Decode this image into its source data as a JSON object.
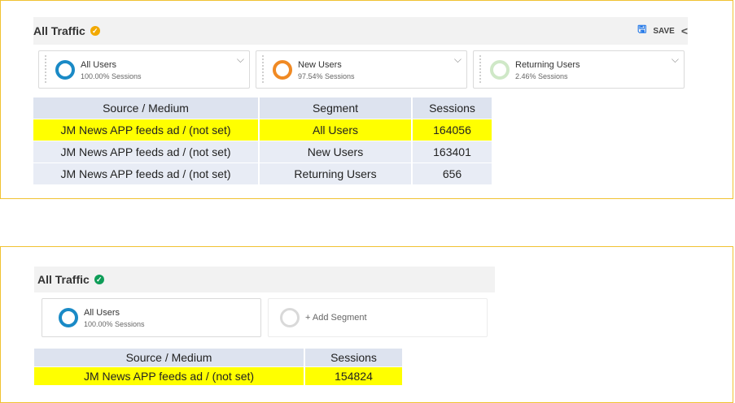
{
  "top_panel": {
    "title": "All Traffic",
    "verified_icon": "check-shield-icon",
    "save_label": "SAVE",
    "segments": [
      {
        "name": "All Users",
        "sub": "100.00% Sessions",
        "color": "#1a8ac6",
        "icon": "segment-ring-icon"
      },
      {
        "name": "New Users",
        "sub": "97.54% Sessions",
        "color": "#f08a24",
        "icon": "segment-ring-icon"
      },
      {
        "name": "Returning Users",
        "sub": "2.46% Sessions",
        "color": "#cfe8c7",
        "icon": "segment-ring-icon"
      }
    ],
    "table": {
      "headers": [
        "Source / Medium",
        "Segment",
        "Sessions"
      ],
      "rows": [
        [
          "JM News APP feeds ad / (not set)",
          "All Users",
          "164056"
        ],
        [
          "JM News APP feeds ad / (not set)",
          "New Users",
          "163401"
        ],
        [
          "JM News APP feeds ad / (not set)",
          "Returning Users",
          "656"
        ]
      ]
    }
  },
  "bottom_panel": {
    "title": "All Traffic",
    "verified_icon": "check-shield-icon",
    "segments": [
      {
        "name": "All Users",
        "sub": "100.00% Sessions",
        "color": "#1a8ac6",
        "icon": "segment-ring-icon"
      }
    ],
    "add_segment_label": "+ Add Segment",
    "table": {
      "headers": [
        "Source / Medium",
        "Sessions"
      ],
      "rows": [
        [
          "JM News APP feeds ad / (not set)",
          "154824"
        ]
      ]
    }
  },
  "colors": {
    "highlight": "#ffff00",
    "panel_border": "#f1c232",
    "header_bg": "#f2f2f2",
    "table_header_bg": "#dde3ef",
    "table_row_bg": "#e8ecf5"
  }
}
